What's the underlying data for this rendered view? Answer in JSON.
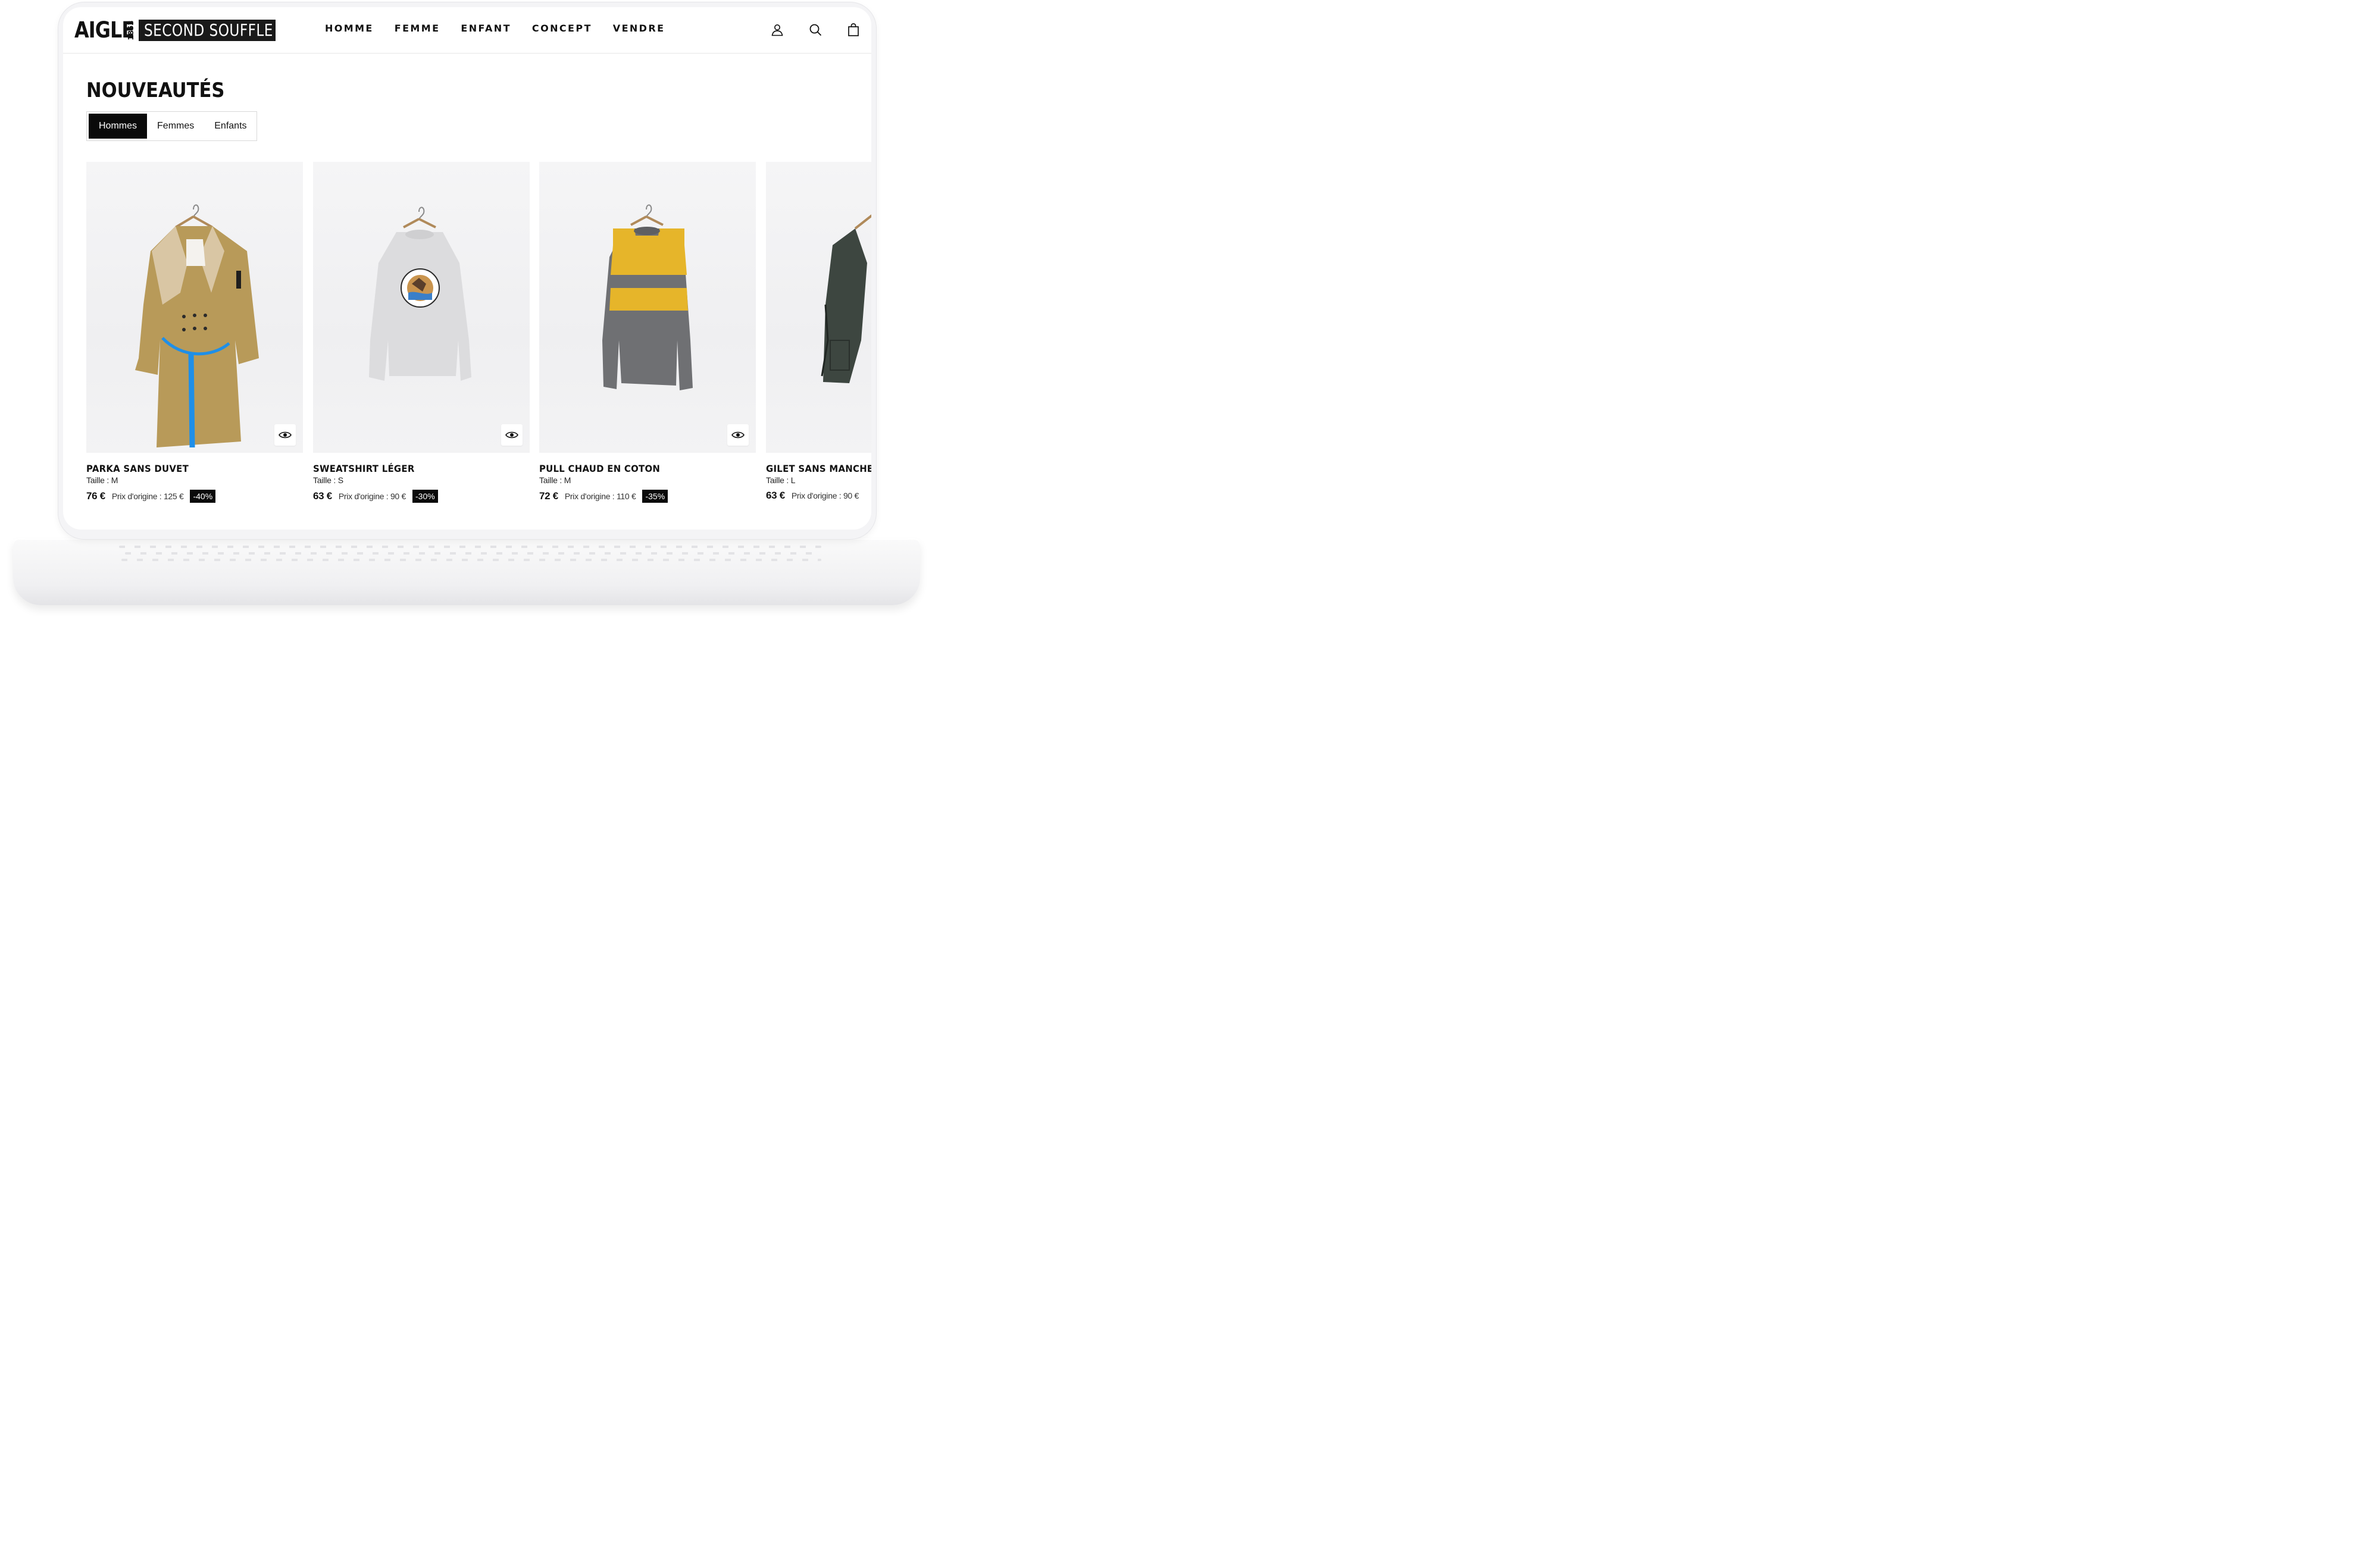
{
  "header": {
    "logo_brand": "AIGLE",
    "logo_year": "1853",
    "logo_tagline": "SECOND SOUFFLE",
    "nav": [
      "HOMME",
      "FEMME",
      "ENFANT",
      "CONCEPT",
      "VENDRE"
    ],
    "icons": [
      "user-icon",
      "search-icon",
      "shopping-bag-icon"
    ]
  },
  "section": {
    "title": "NOUVEAUTÉS",
    "tabs": [
      {
        "label": "Hommes",
        "active": true
      },
      {
        "label": "Femmes",
        "active": false
      },
      {
        "label": "Enfants",
        "active": false
      }
    ]
  },
  "products": [
    {
      "name": "PARKA SANS DUVET",
      "size": "Taille : M",
      "price": "76 €",
      "original": "Prix d'origine : 125 €",
      "discount": "-40%",
      "image": "beige trench coat with blue belt on hanger"
    },
    {
      "name": "SWEATSHIRT LÉGER",
      "size": "Taille : S",
      "price": "63 €",
      "original": "Prix d'origine : 90 €",
      "discount": "-30%",
      "image": "light grey sweatshirt with circular print"
    },
    {
      "name": "PULL CHAUD EN COTON",
      "size": "Taille : M",
      "price": "72 €",
      "original": "Prix d'origine : 110 €",
      "discount": "-35%",
      "image": "grey and yellow striped sweater"
    },
    {
      "name": "GILET SANS MANCHES",
      "size": "Taille : L",
      "price": "63 €",
      "original": "Prix d'origine : 90 €",
      "discount": "",
      "image": "dark green sleeveless vest"
    }
  ],
  "quick_view_icon": "eye-icon",
  "colors": {
    "accent": "#0a0a0a",
    "background": "#ffffff",
    "card_background": "#f2f2f3"
  }
}
